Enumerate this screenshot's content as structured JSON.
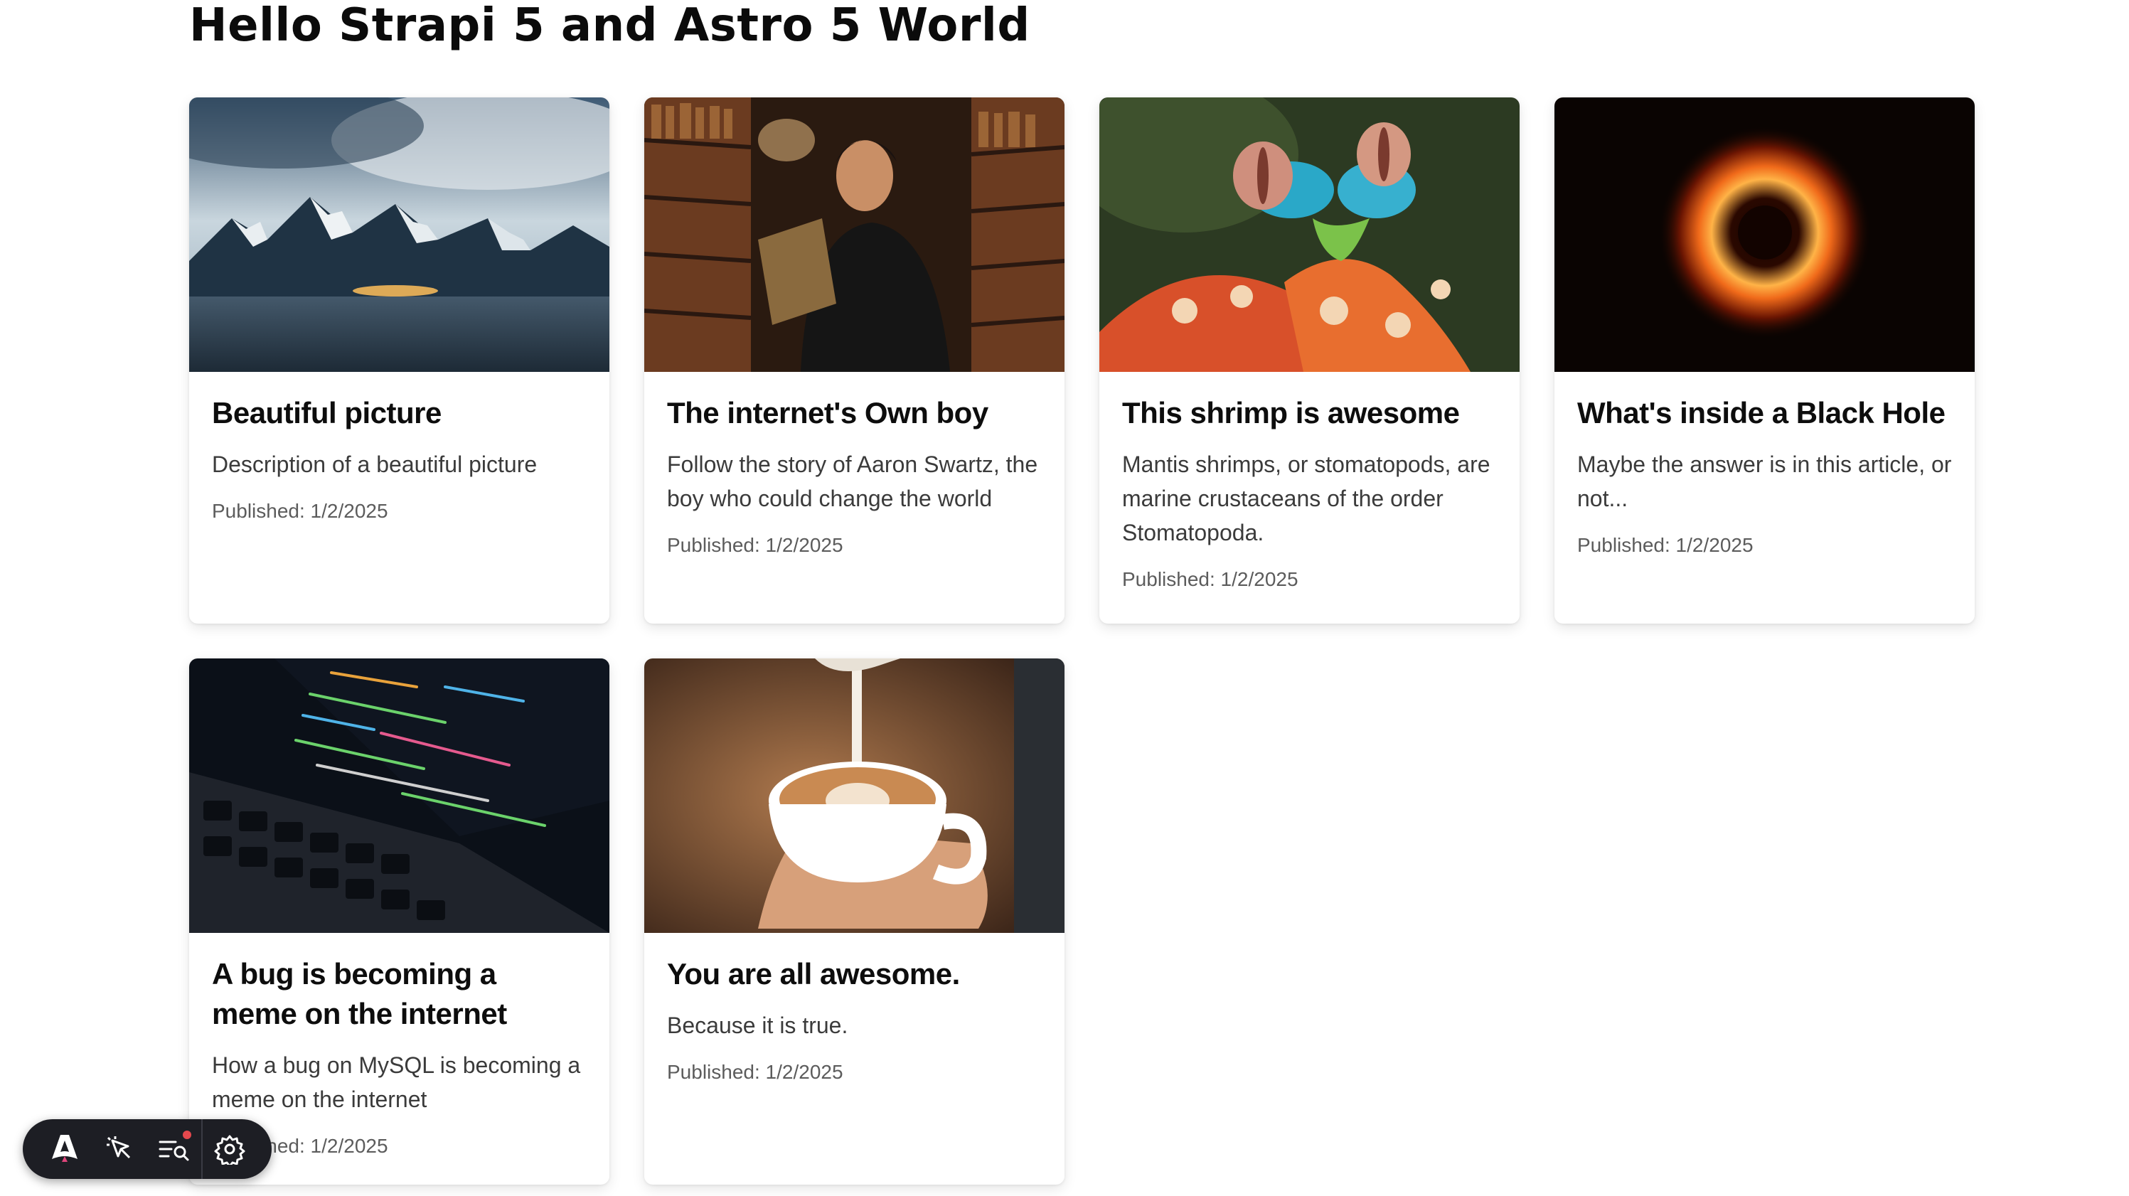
{
  "page": {
    "title": "Hello Strapi 5 and Astro 5 World"
  },
  "articles": [
    {
      "title": "Beautiful picture",
      "description": "Description of a beautiful picture",
      "published": "Published: 1/2/2025",
      "image": "mountain-landscape"
    },
    {
      "title": "The internet's Own boy",
      "description": "Follow the story of Aaron Swartz, the boy who could change the world",
      "published": "Published: 1/2/2025",
      "image": "man-in-library"
    },
    {
      "title": "This shrimp is awesome",
      "description": "Mantis shrimps, or stomatopods, are marine crustaceans of the order Stomatopoda.",
      "published": "Published: 1/2/2025",
      "image": "mantis-shrimp"
    },
    {
      "title": "What's inside a Black Hole",
      "description": "Maybe the answer is in this article, or not...",
      "published": "Published: 1/2/2025",
      "image": "black-hole"
    },
    {
      "title": "A bug is becoming a meme on the internet",
      "description": "How a bug on MySQL is becoming a meme on the internet",
      "published": "Published: 1/2/2025",
      "image": "laptop-code"
    },
    {
      "title": "You are all awesome.",
      "description": "Because it is true.",
      "published": "Published: 1/2/2025",
      "image": "latte-art"
    }
  ],
  "toolbar": {
    "items": [
      "astro-logo-icon",
      "inspect-cursor-icon",
      "audit-list-icon",
      "settings-gear-icon"
    ],
    "notification_color": "#e5484d"
  }
}
